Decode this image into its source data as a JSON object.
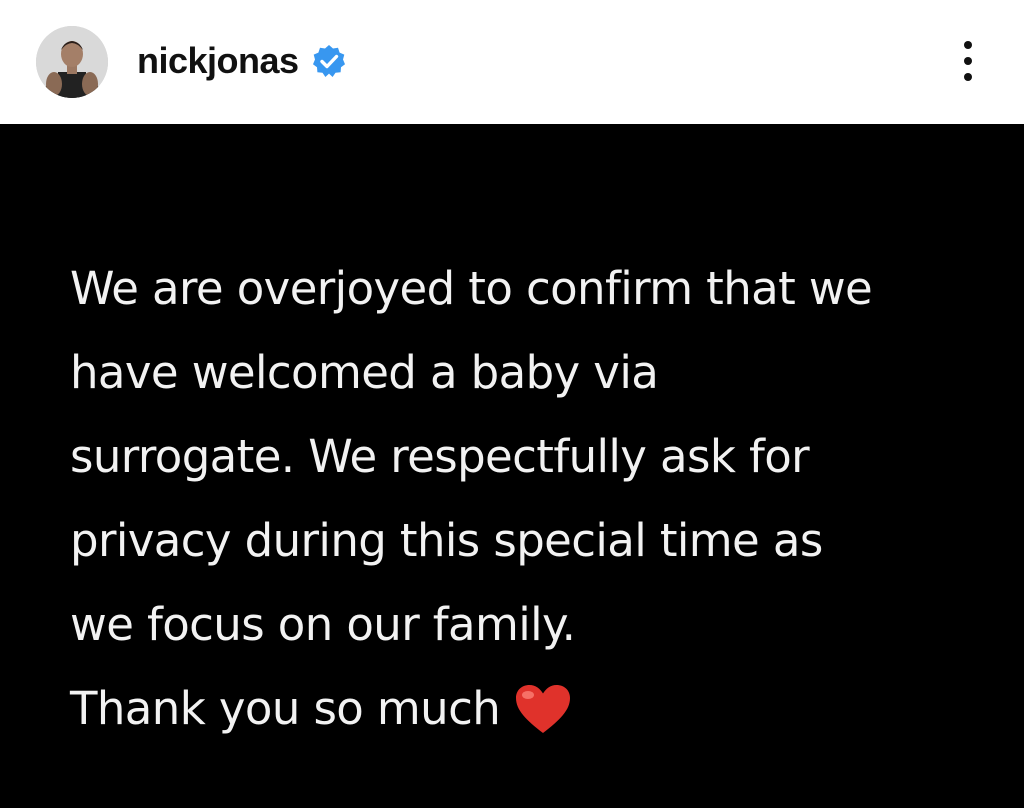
{
  "header": {
    "username": "nickjonas",
    "avatar_icon": "profile-photo-avatar",
    "verified_icon": "verified-badge-icon",
    "verified_color": "#3897f0",
    "more_icon": "more-options-icon"
  },
  "post": {
    "background": "#000000",
    "text_color": "#f2f2f2",
    "lines": [
      "We are overjoyed to confirm that we",
      "have welcomed a baby via",
      "surrogate. We respectfully ask for",
      "privacy during this special time as",
      "we focus on our family.",
      "Thank you so much"
    ],
    "emoji_icon": "red-heart-icon",
    "emoji_color": "#e0322b"
  }
}
